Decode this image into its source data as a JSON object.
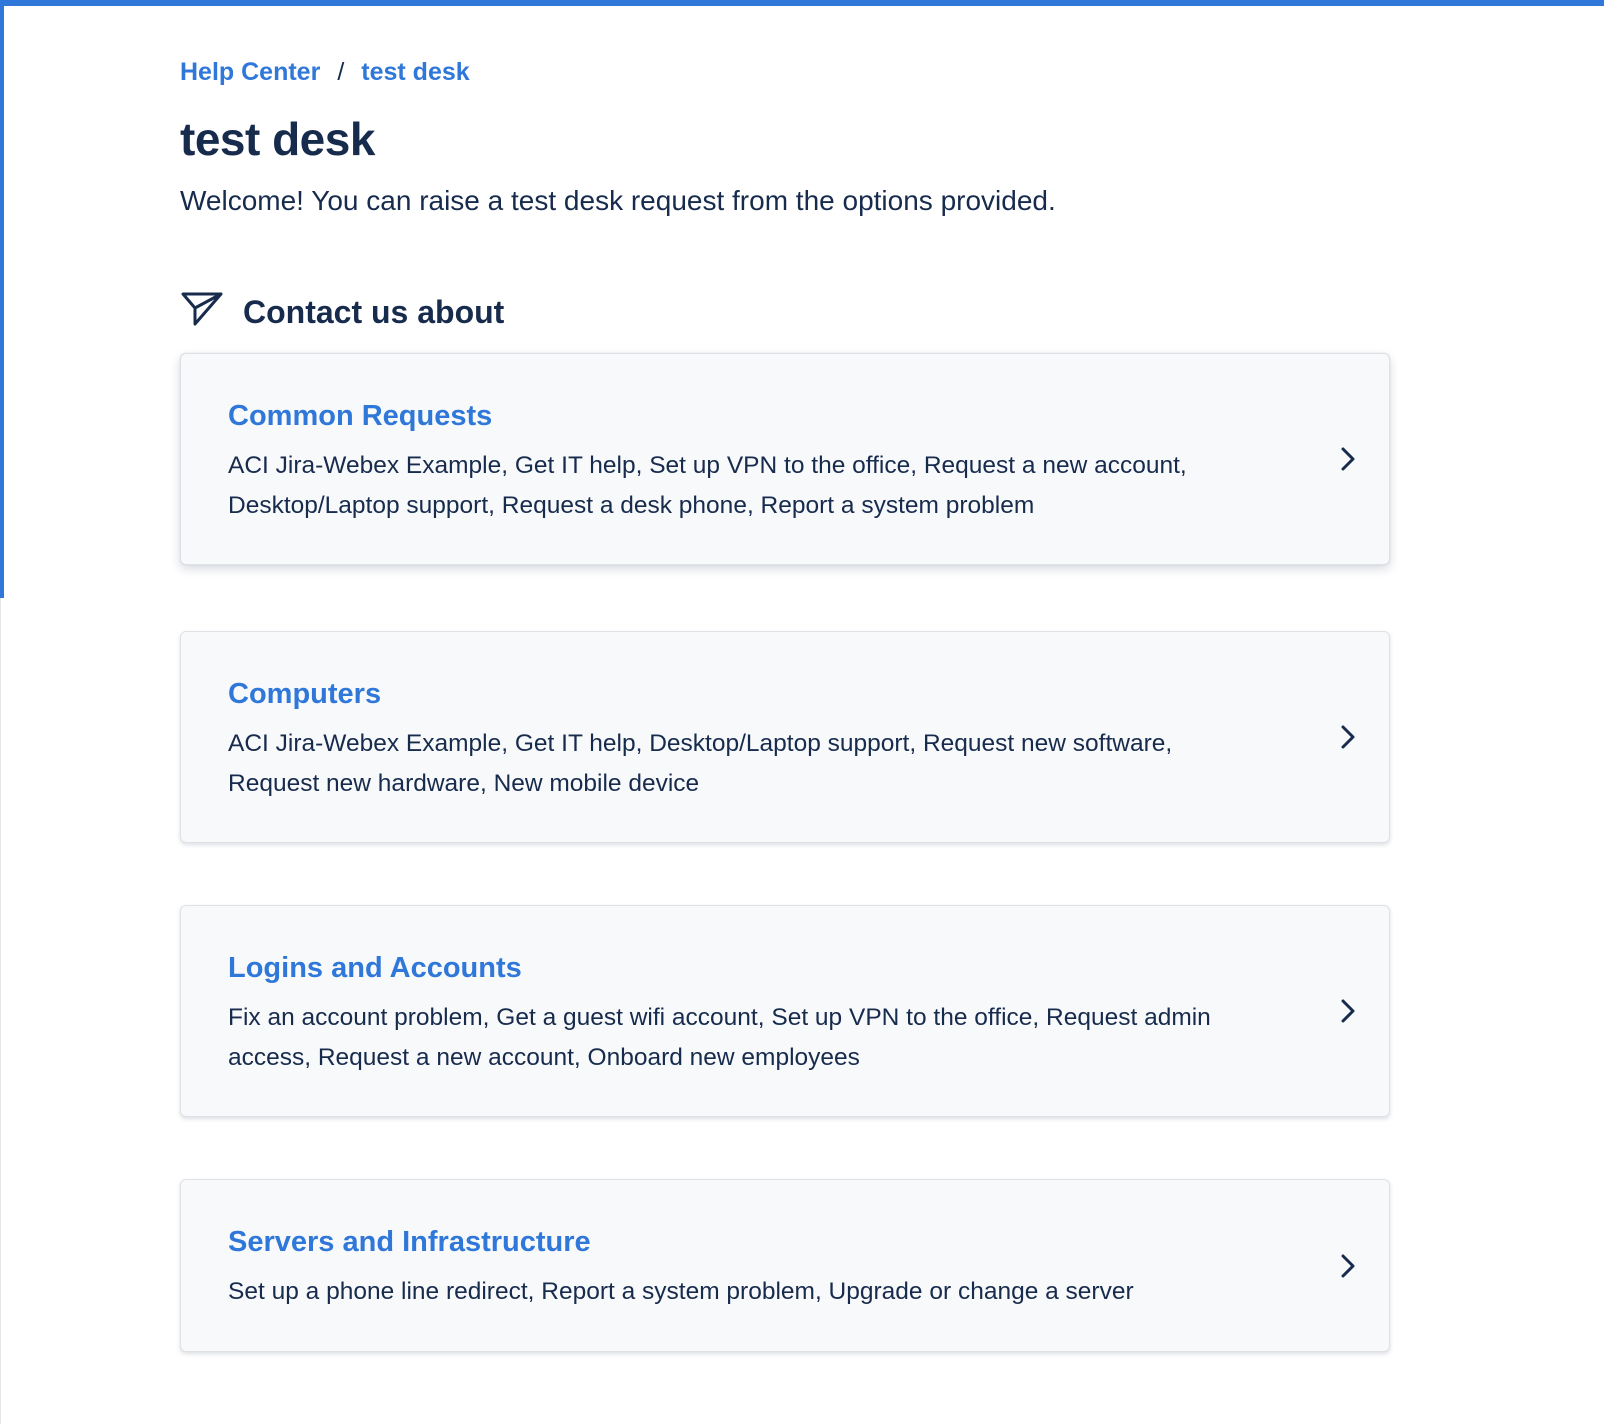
{
  "breadcrumb": {
    "items": [
      {
        "label": "Help Center"
      },
      {
        "label": "test desk"
      }
    ],
    "separator": "/"
  },
  "page": {
    "title": "test desk",
    "welcome": "Welcome! You can raise a test desk request from the options provided."
  },
  "section": {
    "icon": "paper-plane-icon",
    "heading": "Contact us about"
  },
  "cards": [
    {
      "title": "Common Requests",
      "description": "ACI Jira-Webex Example, Get IT help, Set up VPN to the office, Request a new account, Desktop/Laptop support, Request a desk phone, Report a system problem",
      "icon": "chevron-right-icon"
    },
    {
      "title": "Computers",
      "description": "ACI Jira-Webex Example, Get IT help, Desktop/Laptop support, Request new software, Request new hardware, New mobile device",
      "icon": "chevron-right-icon"
    },
    {
      "title": "Logins and Accounts",
      "description": "Fix an account problem, Get a guest wifi account, Set up VPN to the office, Request admin access, Request a new account, Onboard new employees",
      "icon": "chevron-right-icon"
    },
    {
      "title": "Servers and Infrastructure",
      "description": "Set up a phone line redirect, Report a system problem, Upgrade or change a server",
      "icon": "chevron-right-icon"
    }
  ],
  "colors": {
    "accent": "#2f77d8",
    "text": "#172b4d",
    "card_bg": "#f8f9fb"
  }
}
